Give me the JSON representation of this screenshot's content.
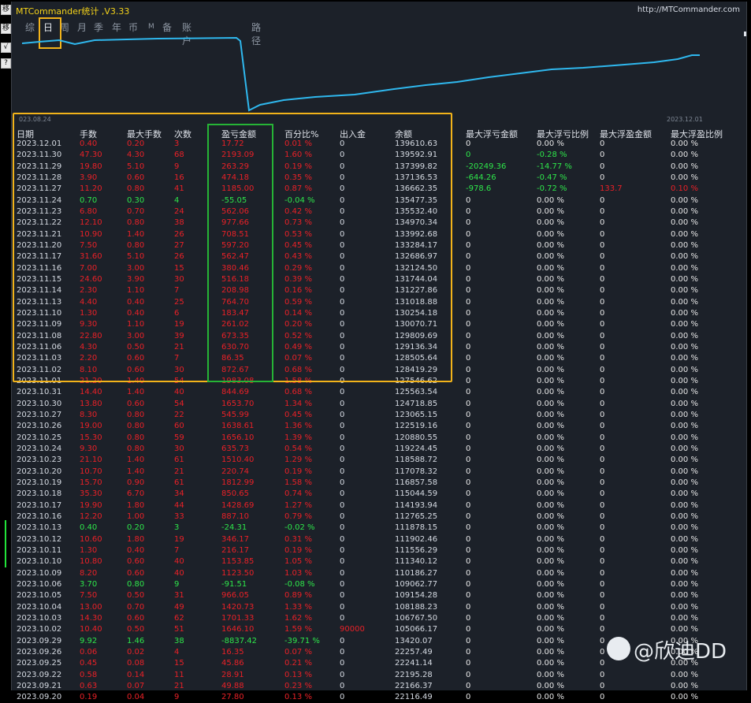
{
  "window": {
    "title": "MTCommander统计 ,V3.33",
    "url": "http://MTCommander.com"
  },
  "toolbar": {
    "icons": [
      "restore-icon",
      "check-icon",
      "question-icon"
    ],
    "labels": [
      "移",
      "√",
      "?"
    ]
  },
  "tabs": [
    "综",
    "日",
    "周",
    "月",
    "季",
    "年",
    "币",
    "M",
    "备",
    "账户",
    "路径"
  ],
  "active_tab": "日",
  "chart": {
    "start_date": "023.08.24",
    "end_date": "2023.12.01",
    "line_color": "#2fb8ee"
  },
  "headers": [
    "日期",
    "手数",
    "最大手数",
    "次数",
    "盈亏金额",
    "百分比%",
    "出入金",
    "余额",
    "最大浮亏金额",
    "最大浮亏比例",
    "最大浮盈金额",
    "最大浮盈比例"
  ],
  "rows": [
    {
      "date": "2023.12.01",
      "lots": "0.40",
      "max_lots": "0.20",
      "count": "3",
      "pnl": "17.72",
      "pct": "0.01 %",
      "io": "0",
      "bal": "139610.63",
      "fl_amt": "0",
      "fl_pct": "0.00 %",
      "fp_amt": "0",
      "fp_pct": "0.00 %",
      "pnl_color": "red",
      "fl_color": "wht",
      "fp_color": "wht"
    },
    {
      "date": "2023.11.30",
      "lots": "47.30",
      "max_lots": "4.30",
      "count": "68",
      "pnl": "2193.09",
      "pct": "1.60 %",
      "io": "0",
      "bal": "139592.91",
      "fl_amt": "0",
      "fl_pct": "-0.28 %",
      "fp_amt": "0",
      "fp_pct": "0.00 %",
      "pnl_color": "red",
      "fl_color": "green",
      "fp_color": "wht"
    },
    {
      "date": "2023.11.29",
      "lots": "19.80",
      "max_lots": "5.10",
      "count": "9",
      "pnl": "263.29",
      "pct": "0.19 %",
      "io": "0",
      "bal": "137399.82",
      "fl_amt": "-20249.36",
      "fl_pct": "-14.77 %",
      "fp_amt": "0",
      "fp_pct": "0.00 %",
      "pnl_color": "red",
      "fl_color": "green",
      "fp_color": "wht"
    },
    {
      "date": "2023.11.28",
      "lots": "3.90",
      "max_lots": "0.60",
      "count": "16",
      "pnl": "474.18",
      "pct": "0.35 %",
      "io": "0",
      "bal": "137136.53",
      "fl_amt": "-644.26",
      "fl_pct": "-0.47 %",
      "fp_amt": "0",
      "fp_pct": "0.00 %",
      "pnl_color": "red",
      "fl_color": "green",
      "fp_color": "wht"
    },
    {
      "date": "2023.11.27",
      "lots": "11.20",
      "max_lots": "0.80",
      "count": "41",
      "pnl": "1185.00",
      "pct": "0.87 %",
      "io": "0",
      "bal": "136662.35",
      "fl_amt": "-978.6",
      "fl_pct": "-0.72 %",
      "fp_amt": "133.7",
      "fp_pct": "0.10 %",
      "pnl_color": "red",
      "fl_color": "green",
      "fp_color": "red"
    },
    {
      "date": "2023.11.24",
      "lots": "0.70",
      "max_lots": "0.30",
      "count": "4",
      "pnl": "-55.05",
      "pct": "-0.04 %",
      "io": "0",
      "bal": "135477.35",
      "fl_amt": "0",
      "fl_pct": "0.00 %",
      "fp_amt": "0",
      "fp_pct": "0.00 %",
      "pnl_color": "green",
      "fl_color": "wht",
      "fp_color": "wht"
    },
    {
      "date": "2023.11.23",
      "lots": "6.80",
      "max_lots": "0.70",
      "count": "24",
      "pnl": "562.06",
      "pct": "0.42 %",
      "io": "0",
      "bal": "135532.40",
      "fl_amt": "0",
      "fl_pct": "0.00 %",
      "fp_amt": "0",
      "fp_pct": "0.00 %",
      "pnl_color": "red",
      "fl_color": "wht",
      "fp_color": "wht"
    },
    {
      "date": "2023.11.22",
      "lots": "12.10",
      "max_lots": "0.80",
      "count": "38",
      "pnl": "977.66",
      "pct": "0.73 %",
      "io": "0",
      "bal": "134970.34",
      "fl_amt": "0",
      "fl_pct": "0.00 %",
      "fp_amt": "0",
      "fp_pct": "0.00 %",
      "pnl_color": "red",
      "fl_color": "wht",
      "fp_color": "wht"
    },
    {
      "date": "2023.11.21",
      "lots": "10.90",
      "max_lots": "1.40",
      "count": "26",
      "pnl": "708.51",
      "pct": "0.53 %",
      "io": "0",
      "bal": "133992.68",
      "fl_amt": "0",
      "fl_pct": "0.00 %",
      "fp_amt": "0",
      "fp_pct": "0.00 %",
      "pnl_color": "red",
      "fl_color": "wht",
      "fp_color": "wht"
    },
    {
      "date": "2023.11.20",
      "lots": "7.50",
      "max_lots": "0.80",
      "count": "27",
      "pnl": "597.20",
      "pct": "0.45 %",
      "io": "0",
      "bal": "133284.17",
      "fl_amt": "0",
      "fl_pct": "0.00 %",
      "fp_amt": "0",
      "fp_pct": "0.00 %",
      "pnl_color": "red",
      "fl_color": "wht",
      "fp_color": "wht"
    },
    {
      "date": "2023.11.17",
      "lots": "31.60",
      "max_lots": "5.10",
      "count": "26",
      "pnl": "562.47",
      "pct": "0.43 %",
      "io": "0",
      "bal": "132686.97",
      "fl_amt": "0",
      "fl_pct": "0.00 %",
      "fp_amt": "0",
      "fp_pct": "0.00 %",
      "pnl_color": "red",
      "fl_color": "wht",
      "fp_color": "wht"
    },
    {
      "date": "2023.11.16",
      "lots": "7.00",
      "max_lots": "3.00",
      "count": "15",
      "pnl": "380.46",
      "pct": "0.29 %",
      "io": "0",
      "bal": "132124.50",
      "fl_amt": "0",
      "fl_pct": "0.00 %",
      "fp_amt": "0",
      "fp_pct": "0.00 %",
      "pnl_color": "red",
      "fl_color": "wht",
      "fp_color": "wht"
    },
    {
      "date": "2023.11.15",
      "lots": "24.60",
      "max_lots": "3.90",
      "count": "30",
      "pnl": "516.18",
      "pct": "0.39 %",
      "io": "0",
      "bal": "131744.04",
      "fl_amt": "0",
      "fl_pct": "0.00 %",
      "fp_amt": "0",
      "fp_pct": "0.00 %",
      "pnl_color": "red",
      "fl_color": "wht",
      "fp_color": "wht"
    },
    {
      "date": "2023.11.14",
      "lots": "2.30",
      "max_lots": "1.10",
      "count": "7",
      "pnl": "208.98",
      "pct": "0.16 %",
      "io": "0",
      "bal": "131227.86",
      "fl_amt": "0",
      "fl_pct": "0.00 %",
      "fp_amt": "0",
      "fp_pct": "0.00 %",
      "pnl_color": "red",
      "fl_color": "wht",
      "fp_color": "wht"
    },
    {
      "date": "2023.11.13",
      "lots": "4.40",
      "max_lots": "0.40",
      "count": "25",
      "pnl": "764.70",
      "pct": "0.59 %",
      "io": "0",
      "bal": "131018.88",
      "fl_amt": "0",
      "fl_pct": "0.00 %",
      "fp_amt": "0",
      "fp_pct": "0.00 %",
      "pnl_color": "red",
      "fl_color": "wht",
      "fp_color": "wht"
    },
    {
      "date": "2023.11.10",
      "lots": "1.30",
      "max_lots": "0.40",
      "count": "6",
      "pnl": "183.47",
      "pct": "0.14 %",
      "io": "0",
      "bal": "130254.18",
      "fl_amt": "0",
      "fl_pct": "0.00 %",
      "fp_amt": "0",
      "fp_pct": "0.00 %",
      "pnl_color": "red",
      "fl_color": "wht",
      "fp_color": "wht"
    },
    {
      "date": "2023.11.09",
      "lots": "9.30",
      "max_lots": "1.10",
      "count": "19",
      "pnl": "261.02",
      "pct": "0.20 %",
      "io": "0",
      "bal": "130070.71",
      "fl_amt": "0",
      "fl_pct": "0.00 %",
      "fp_amt": "0",
      "fp_pct": "0.00 %",
      "pnl_color": "red",
      "fl_color": "wht",
      "fp_color": "wht"
    },
    {
      "date": "2023.11.08",
      "lots": "22.80",
      "max_lots": "3.00",
      "count": "39",
      "pnl": "673.35",
      "pct": "0.52 %",
      "io": "0",
      "bal": "129809.69",
      "fl_amt": "0",
      "fl_pct": "0.00 %",
      "fp_amt": "0",
      "fp_pct": "0.00 %",
      "pnl_color": "red",
      "fl_color": "wht",
      "fp_color": "wht"
    },
    {
      "date": "2023.11.06",
      "lots": "4.30",
      "max_lots": "0.50",
      "count": "21",
      "pnl": "630.70",
      "pct": "0.49 %",
      "io": "0",
      "bal": "129136.34",
      "fl_amt": "0",
      "fl_pct": "0.00 %",
      "fp_amt": "0",
      "fp_pct": "0.00 %",
      "pnl_color": "red",
      "fl_color": "wht",
      "fp_color": "wht"
    },
    {
      "date": "2023.11.03",
      "lots": "2.20",
      "max_lots": "0.60",
      "count": "7",
      "pnl": "86.35",
      "pct": "0.07 %",
      "io": "0",
      "bal": "128505.64",
      "fl_amt": "0",
      "fl_pct": "0.00 %",
      "fp_amt": "0",
      "fp_pct": "0.00 %",
      "pnl_color": "red",
      "fl_color": "wht",
      "fp_color": "wht"
    },
    {
      "date": "2023.11.02",
      "lots": "8.10",
      "max_lots": "0.60",
      "count": "30",
      "pnl": "872.67",
      "pct": "0.68 %",
      "io": "0",
      "bal": "128419.29",
      "fl_amt": "0",
      "fl_pct": "0.00 %",
      "fp_amt": "0",
      "fp_pct": "0.00 %",
      "pnl_color": "red",
      "fl_color": "wht",
      "fp_color": "wht"
    },
    {
      "date": "2023.11.01",
      "lots": "21.20",
      "max_lots": "1.40",
      "count": "54",
      "pnl": "1983.08",
      "pct": "1.58 %",
      "io": "0",
      "bal": "127546.62",
      "fl_amt": "0",
      "fl_pct": "0.00 %",
      "fp_amt": "0",
      "fp_pct": "0.00 %",
      "pnl_color": "red",
      "fl_color": "wht",
      "fp_color": "wht"
    },
    {
      "date": "2023.10.31",
      "lots": "14.40",
      "max_lots": "1.40",
      "count": "40",
      "pnl": "844.69",
      "pct": "0.68 %",
      "io": "0",
      "bal": "125563.54",
      "fl_amt": "0",
      "fl_pct": "0.00 %",
      "fp_amt": "0",
      "fp_pct": "0.00 %",
      "pnl_color": "red",
      "fl_color": "wht",
      "fp_color": "wht"
    },
    {
      "date": "2023.10.30",
      "lots": "13.80",
      "max_lots": "0.60",
      "count": "54",
      "pnl": "1653.70",
      "pct": "1.34 %",
      "io": "0",
      "bal": "124718.85",
      "fl_amt": "0",
      "fl_pct": "0.00 %",
      "fp_amt": "0",
      "fp_pct": "0.00 %",
      "pnl_color": "red",
      "fl_color": "wht",
      "fp_color": "wht"
    },
    {
      "date": "2023.10.27",
      "lots": "8.30",
      "max_lots": "0.80",
      "count": "22",
      "pnl": "545.99",
      "pct": "0.45 %",
      "io": "0",
      "bal": "123065.15",
      "fl_amt": "0",
      "fl_pct": "0.00 %",
      "fp_amt": "0",
      "fp_pct": "0.00 %",
      "pnl_color": "red",
      "fl_color": "wht",
      "fp_color": "wht"
    },
    {
      "date": "2023.10.26",
      "lots": "19.00",
      "max_lots": "0.80",
      "count": "60",
      "pnl": "1638.61",
      "pct": "1.36 %",
      "io": "0",
      "bal": "122519.16",
      "fl_amt": "0",
      "fl_pct": "0.00 %",
      "fp_amt": "0",
      "fp_pct": "0.00 %",
      "pnl_color": "red",
      "fl_color": "wht",
      "fp_color": "wht"
    },
    {
      "date": "2023.10.25",
      "lots": "15.30",
      "max_lots": "0.80",
      "count": "59",
      "pnl": "1656.10",
      "pct": "1.39 %",
      "io": "0",
      "bal": "120880.55",
      "fl_amt": "0",
      "fl_pct": "0.00 %",
      "fp_amt": "0",
      "fp_pct": "0.00 %",
      "pnl_color": "red",
      "fl_color": "wht",
      "fp_color": "wht"
    },
    {
      "date": "2023.10.24",
      "lots": "9.30",
      "max_lots": "0.80",
      "count": "30",
      "pnl": "635.73",
      "pct": "0.54 %",
      "io": "0",
      "bal": "119224.45",
      "fl_amt": "0",
      "fl_pct": "0.00 %",
      "fp_amt": "0",
      "fp_pct": "0.00 %",
      "pnl_color": "red",
      "fl_color": "wht",
      "fp_color": "wht"
    },
    {
      "date": "2023.10.23",
      "lots": "21.10",
      "max_lots": "1.40",
      "count": "61",
      "pnl": "1510.40",
      "pct": "1.29 %",
      "io": "0",
      "bal": "118588.72",
      "fl_amt": "0",
      "fl_pct": "0.00 %",
      "fp_amt": "0",
      "fp_pct": "0.00 %",
      "pnl_color": "red",
      "fl_color": "wht",
      "fp_color": "wht"
    },
    {
      "date": "2023.10.20",
      "lots": "10.70",
      "max_lots": "1.40",
      "count": "21",
      "pnl": "220.74",
      "pct": "0.19 %",
      "io": "0",
      "bal": "117078.32",
      "fl_amt": "0",
      "fl_pct": "0.00 %",
      "fp_amt": "0",
      "fp_pct": "0.00 %",
      "pnl_color": "red",
      "fl_color": "wht",
      "fp_color": "wht"
    },
    {
      "date": "2023.10.19",
      "lots": "15.70",
      "max_lots": "0.90",
      "count": "61",
      "pnl": "1812.99",
      "pct": "1.58 %",
      "io": "0",
      "bal": "116857.58",
      "fl_amt": "0",
      "fl_pct": "0.00 %",
      "fp_amt": "0",
      "fp_pct": "0.00 %",
      "pnl_color": "red",
      "fl_color": "wht",
      "fp_color": "wht"
    },
    {
      "date": "2023.10.18",
      "lots": "35.30",
      "max_lots": "6.70",
      "count": "34",
      "pnl": "850.65",
      "pct": "0.74 %",
      "io": "0",
      "bal": "115044.59",
      "fl_amt": "0",
      "fl_pct": "0.00 %",
      "fp_amt": "0",
      "fp_pct": "0.00 %",
      "pnl_color": "red",
      "fl_color": "wht",
      "fp_color": "wht"
    },
    {
      "date": "2023.10.17",
      "lots": "19.90",
      "max_lots": "1.80",
      "count": "44",
      "pnl": "1428.69",
      "pct": "1.27 %",
      "io": "0",
      "bal": "114193.94",
      "fl_amt": "0",
      "fl_pct": "0.00 %",
      "fp_amt": "0",
      "fp_pct": "0.00 %",
      "pnl_color": "red",
      "fl_color": "wht",
      "fp_color": "wht"
    },
    {
      "date": "2023.10.16",
      "lots": "12.20",
      "max_lots": "1.00",
      "count": "33",
      "pnl": "887.10",
      "pct": "0.79 %",
      "io": "0",
      "bal": "112765.25",
      "fl_amt": "0",
      "fl_pct": "0.00 %",
      "fp_amt": "0",
      "fp_pct": "0.00 %",
      "pnl_color": "red",
      "fl_color": "wht",
      "fp_color": "wht"
    },
    {
      "date": "2023.10.13",
      "lots": "0.40",
      "max_lots": "0.20",
      "count": "3",
      "pnl": "-24.31",
      "pct": "-0.02 %",
      "io": "0",
      "bal": "111878.15",
      "fl_amt": "0",
      "fl_pct": "0.00 %",
      "fp_amt": "0",
      "fp_pct": "0.00 %",
      "pnl_color": "green",
      "fl_color": "wht",
      "fp_color": "wht"
    },
    {
      "date": "2023.10.12",
      "lots": "10.60",
      "max_lots": "1.80",
      "count": "19",
      "pnl": "346.17",
      "pct": "0.31 %",
      "io": "0",
      "bal": "111902.46",
      "fl_amt": "0",
      "fl_pct": "0.00 %",
      "fp_amt": "0",
      "fp_pct": "0.00 %",
      "pnl_color": "red",
      "fl_color": "wht",
      "fp_color": "wht"
    },
    {
      "date": "2023.10.11",
      "lots": "1.30",
      "max_lots": "0.40",
      "count": "7",
      "pnl": "216.17",
      "pct": "0.19 %",
      "io": "0",
      "bal": "111556.29",
      "fl_amt": "0",
      "fl_pct": "0.00 %",
      "fp_amt": "0",
      "fp_pct": "0.00 %",
      "pnl_color": "red",
      "fl_color": "wht",
      "fp_color": "wht"
    },
    {
      "date": "2023.10.10",
      "lots": "10.80",
      "max_lots": "0.60",
      "count": "40",
      "pnl": "1153.85",
      "pct": "1.05 %",
      "io": "0",
      "bal": "111340.12",
      "fl_amt": "0",
      "fl_pct": "0.00 %",
      "fp_amt": "0",
      "fp_pct": "0.00 %",
      "pnl_color": "red",
      "fl_color": "wht",
      "fp_color": "wht"
    },
    {
      "date": "2023.10.09",
      "lots": "8.20",
      "max_lots": "0.60",
      "count": "40",
      "pnl": "1123.50",
      "pct": "1.03 %",
      "io": "0",
      "bal": "110186.27",
      "fl_amt": "0",
      "fl_pct": "0.00 %",
      "fp_amt": "0",
      "fp_pct": "0.00 %",
      "pnl_color": "red",
      "fl_color": "wht",
      "fp_color": "wht"
    },
    {
      "date": "2023.10.06",
      "lots": "3.70",
      "max_lots": "0.80",
      "count": "9",
      "pnl": "-91.51",
      "pct": "-0.08 %",
      "io": "0",
      "bal": "109062.77",
      "fl_amt": "0",
      "fl_pct": "0.00 %",
      "fp_amt": "0",
      "fp_pct": "0.00 %",
      "pnl_color": "green",
      "fl_color": "wht",
      "fp_color": "wht"
    },
    {
      "date": "2023.10.05",
      "lots": "7.50",
      "max_lots": "0.50",
      "count": "31",
      "pnl": "966.05",
      "pct": "0.89 %",
      "io": "0",
      "bal": "109154.28",
      "fl_amt": "0",
      "fl_pct": "0.00 %",
      "fp_amt": "0",
      "fp_pct": "0.00 %",
      "pnl_color": "red",
      "fl_color": "wht",
      "fp_color": "wht"
    },
    {
      "date": "2023.10.04",
      "lots": "13.00",
      "max_lots": "0.70",
      "count": "49",
      "pnl": "1420.73",
      "pct": "1.33 %",
      "io": "0",
      "bal": "108188.23",
      "fl_amt": "0",
      "fl_pct": "0.00 %",
      "fp_amt": "0",
      "fp_pct": "0.00 %",
      "pnl_color": "red",
      "fl_color": "wht",
      "fp_color": "wht"
    },
    {
      "date": "2023.10.03",
      "lots": "14.30",
      "max_lots": "0.60",
      "count": "62",
      "pnl": "1701.33",
      "pct": "1.62 %",
      "io": "0",
      "bal": "106767.50",
      "fl_amt": "0",
      "fl_pct": "0.00 %",
      "fp_amt": "0",
      "fp_pct": "0.00 %",
      "pnl_color": "red",
      "fl_color": "wht",
      "fp_color": "wht"
    },
    {
      "date": "2023.10.02",
      "lots": "10.40",
      "max_lots": "0.50",
      "count": "51",
      "pnl": "1646.10",
      "pct": "1.59 %",
      "io": "90000",
      "bal": "105066.17",
      "fl_amt": "0",
      "fl_pct": "0.00 %",
      "fp_amt": "0",
      "fp_pct": "0.00 %",
      "pnl_color": "red",
      "io_color": "red",
      "fl_color": "wht",
      "fp_color": "wht"
    },
    {
      "date": "2023.09.29",
      "lots": "9.92",
      "max_lots": "1.46",
      "count": "38",
      "pnl": "-8837.42",
      "pct": "-39.71 %",
      "io": "0",
      "bal": "13420.07",
      "fl_amt": "0",
      "fl_pct": "0.00 %",
      "fp_amt": "0",
      "fp_pct": "0.00 %",
      "pnl_color": "green",
      "fl_color": "wht",
      "fp_color": "wht"
    },
    {
      "date": "2023.09.26",
      "lots": "0.06",
      "max_lots": "0.02",
      "count": "4",
      "pnl": "16.35",
      "pct": "0.07 %",
      "io": "0",
      "bal": "22257.49",
      "fl_amt": "0",
      "fl_pct": "0.00 %",
      "fp_amt": "0",
      "fp_pct": "0.00 %",
      "pnl_color": "red",
      "fl_color": "wht",
      "fp_color": "wht"
    },
    {
      "date": "2023.09.25",
      "lots": "0.45",
      "max_lots": "0.08",
      "count": "15",
      "pnl": "45.86",
      "pct": "0.21 %",
      "io": "0",
      "bal": "22241.14",
      "fl_amt": "0",
      "fl_pct": "0.00 %",
      "fp_amt": "0",
      "fp_pct": "0.00 %",
      "pnl_color": "red",
      "fl_color": "wht",
      "fp_color": "wht"
    },
    {
      "date": "2023.09.22",
      "lots": "0.58",
      "max_lots": "0.14",
      "count": "11",
      "pnl": "28.91",
      "pct": "0.13 %",
      "io": "0",
      "bal": "22195.28",
      "fl_amt": "0",
      "fl_pct": "0.00 %",
      "fp_amt": "0",
      "fp_pct": "0.00 %",
      "pnl_color": "red",
      "fl_color": "wht",
      "fp_color": "wht"
    },
    {
      "date": "2023.09.21",
      "lots": "0.63",
      "max_lots": "0.07",
      "count": "21",
      "pnl": "49.88",
      "pct": "0.23 %",
      "io": "0",
      "bal": "22166.37",
      "fl_amt": "0",
      "fl_pct": "0.00 %",
      "fp_amt": "0",
      "fp_pct": "0.00 %",
      "pnl_color": "red",
      "fl_color": "wht",
      "fp_color": "wht"
    },
    {
      "date": "2023.09.20",
      "lots": "0.19",
      "max_lots": "0.04",
      "count": "9",
      "pnl": "27.80",
      "pct": "0.13 %",
      "io": "0",
      "bal": "22116.49",
      "fl_amt": "0",
      "fl_pct": "0.00 %",
      "fp_amt": "0",
      "fp_pct": "0.00 %",
      "pnl_color": "red",
      "fl_color": "wht",
      "fp_color": "wht"
    }
  ],
  "watermark": {
    "text": "@欣迪DD",
    "icon": "facebook-icon"
  }
}
